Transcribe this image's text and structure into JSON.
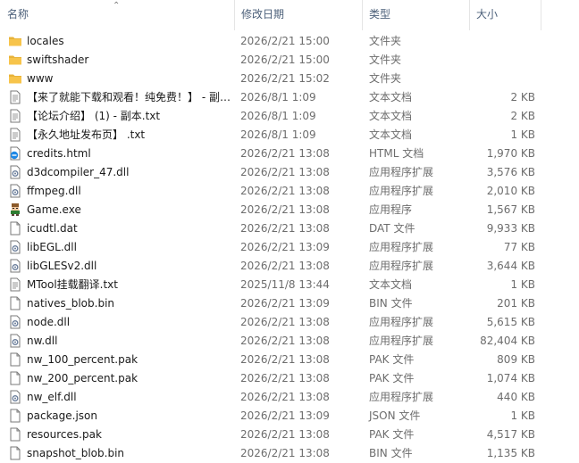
{
  "columns": {
    "name": "名称",
    "date": "修改日期",
    "type": "类型",
    "size": "大小"
  },
  "files": [
    {
      "icon": "folder-icon",
      "name": "locales",
      "date": "2026/2/21 15:00",
      "type": "文件夹",
      "size": ""
    },
    {
      "icon": "folder-icon",
      "name": "swiftshader",
      "date": "2026/2/21 15:00",
      "type": "文件夹",
      "size": ""
    },
    {
      "icon": "folder-icon",
      "name": "www",
      "date": "2026/2/21 15:02",
      "type": "文件夹",
      "size": ""
    },
    {
      "icon": "text-file-icon",
      "name": "【来了就能下载和观看！纯免费！】 - 副…",
      "date": "2026/8/1 1:09",
      "type": "文本文档",
      "size": "2 KB"
    },
    {
      "icon": "text-file-icon",
      "name": "【论坛介绍】 (1) - 副本.txt",
      "date": "2026/8/1 1:09",
      "type": "文本文档",
      "size": "2 KB"
    },
    {
      "icon": "text-file-icon",
      "name": "【永久地址发布页】 .txt",
      "date": "2026/8/1 1:09",
      "type": "文本文档",
      "size": "1 KB"
    },
    {
      "icon": "html-file-icon",
      "name": "credits.html",
      "date": "2026/2/21 13:08",
      "type": "HTML 文档",
      "size": "1,970 KB"
    },
    {
      "icon": "dll-file-icon",
      "name": "d3dcompiler_47.dll",
      "date": "2026/2/21 13:08",
      "type": "应用程序扩展",
      "size": "3,576 KB"
    },
    {
      "icon": "dll-file-icon",
      "name": "ffmpeg.dll",
      "date": "2026/2/21 13:08",
      "type": "应用程序扩展",
      "size": "2,010 KB"
    },
    {
      "icon": "game-exe-icon",
      "name": "Game.exe",
      "date": "2026/2/21 13:08",
      "type": "应用程序",
      "size": "1,567 KB"
    },
    {
      "icon": "blank-file-icon",
      "name": "icudtl.dat",
      "date": "2026/2/21 13:08",
      "type": "DAT 文件",
      "size": "9,933 KB"
    },
    {
      "icon": "dll-file-icon",
      "name": "libEGL.dll",
      "date": "2026/2/21 13:09",
      "type": "应用程序扩展",
      "size": "77 KB"
    },
    {
      "icon": "dll-file-icon",
      "name": "libGLESv2.dll",
      "date": "2026/2/21 13:08",
      "type": "应用程序扩展",
      "size": "3,644 KB"
    },
    {
      "icon": "text-file-icon",
      "name": "MTool挂载翻译.txt",
      "date": "2025/11/8 13:44",
      "type": "文本文档",
      "size": "1 KB"
    },
    {
      "icon": "blank-file-icon",
      "name": "natives_blob.bin",
      "date": "2026/2/21 13:09",
      "type": "BIN 文件",
      "size": "201 KB"
    },
    {
      "icon": "dll-file-icon",
      "name": "node.dll",
      "date": "2026/2/21 13:08",
      "type": "应用程序扩展",
      "size": "5,615 KB"
    },
    {
      "icon": "dll-file-icon",
      "name": "nw.dll",
      "date": "2026/2/21 13:08",
      "type": "应用程序扩展",
      "size": "82,404 KB"
    },
    {
      "icon": "blank-file-icon",
      "name": "nw_100_percent.pak",
      "date": "2026/2/21 13:08",
      "type": "PAK 文件",
      "size": "809 KB"
    },
    {
      "icon": "blank-file-icon",
      "name": "nw_200_percent.pak",
      "date": "2026/2/21 13:08",
      "type": "PAK 文件",
      "size": "1,074 KB"
    },
    {
      "icon": "dll-file-icon",
      "name": "nw_elf.dll",
      "date": "2026/2/21 13:08",
      "type": "应用程序扩展",
      "size": "440 KB"
    },
    {
      "icon": "blank-file-icon",
      "name": "package.json",
      "date": "2026/2/21 13:09",
      "type": "JSON 文件",
      "size": "1 KB"
    },
    {
      "icon": "blank-file-icon",
      "name": "resources.pak",
      "date": "2026/2/21 13:08",
      "type": "PAK 文件",
      "size": "4,517 KB"
    },
    {
      "icon": "blank-file-icon",
      "name": "snapshot_blob.bin",
      "date": "2026/2/21 13:08",
      "type": "BIN 文件",
      "size": "1,135 KB"
    }
  ],
  "colors": {
    "folder": "#f7c44b",
    "header_text": "#4c607a",
    "secondary_text": "#6d6d6d"
  }
}
